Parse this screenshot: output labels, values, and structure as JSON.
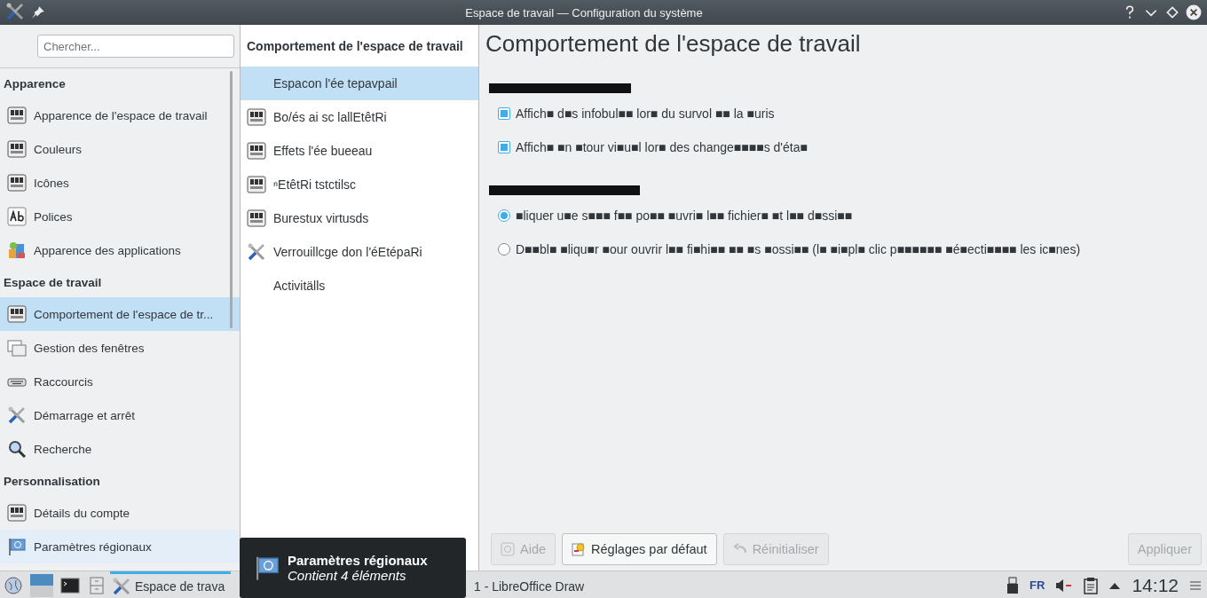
{
  "window": {
    "title": "Espace de travail — Configuration du système"
  },
  "sidebar": {
    "search": {
      "placeholder": "Chercher..."
    },
    "groups": [
      {
        "label": "Apparence",
        "items": [
          {
            "label": "Apparence de l'espace de travail",
            "kind": "module",
            "selected": false,
            "hovered": false
          },
          {
            "label": "Couleurs",
            "kind": "module",
            "selected": false,
            "hovered": false
          },
          {
            "label": "Icônes",
            "kind": "module",
            "selected": false,
            "hovered": false
          },
          {
            "label": "Polices",
            "kind": "font",
            "selected": false,
            "hovered": false
          },
          {
            "label": "Apparence des applications",
            "kind": "apps",
            "selected": false,
            "hovered": false
          }
        ]
      },
      {
        "label": "Espace de travail",
        "items": [
          {
            "label": "Comportement de l'espace de tr...",
            "kind": "module",
            "selected": true,
            "hovered": false
          },
          {
            "label": "Gestion des fenêtres",
            "kind": "windows",
            "selected": false,
            "hovered": false
          },
          {
            "label": "Raccourcis",
            "kind": "keyboard",
            "selected": false,
            "hovered": false
          },
          {
            "label": "Démarrage et arrêt",
            "kind": "tools",
            "selected": false,
            "hovered": false
          },
          {
            "label": "Recherche",
            "kind": "search",
            "selected": false,
            "hovered": false
          }
        ]
      },
      {
        "label": "Personnalisation",
        "items": [
          {
            "label": "Détails du compte",
            "kind": "module",
            "selected": false,
            "hovered": false
          },
          {
            "label": "Paramètres régionaux",
            "kind": "flag",
            "selected": false,
            "hovered": true
          }
        ]
      }
    ]
  },
  "modules": {
    "header": "Comportement de l'espace de travail",
    "items": [
      {
        "label": "Espacon l'ée tepavpail",
        "kind": "plain",
        "selected": true
      },
      {
        "label": "Bo/és ai sc lallEtêtRi",
        "kind": "module",
        "selected": false
      },
      {
        "label": "Effets l'ée bueeau",
        "kind": "module",
        "selected": false
      },
      {
        "label": "ⁿEtêtRi tstctilsc",
        "kind": "module",
        "selected": false
      },
      {
        "label": "Burestux virtusds",
        "kind": "module",
        "selected": false
      },
      {
        "label": "Verrouillcge don l'éEtépaRi",
        "kind": "tools",
        "selected": false
      },
      {
        "label": "Activitälls",
        "kind": "plain",
        "selected": false
      }
    ]
  },
  "page": {
    "title": "Comportement de l'espace de travail",
    "sections": [
      {
        "kind": "checkbox",
        "options": [
          {
            "label": "Affich■ d■s infobul■■ lor■ du survol ■■ la ■uris",
            "checked": true
          },
          {
            "label": "Affich■ ■n ■tour vi■u■l lor■ des change■■■■s d'éta■",
            "checked": true
          }
        ]
      },
      {
        "kind": "radio",
        "options": [
          {
            "label": "■liquer u■e s■■■ f■■ po■■ ■uvri■ l■■ fichier■ ■t l■■ d■ssi■■",
            "selected": true
          },
          {
            "label": "D■■bl■ ■liqu■r ■our ouvrir l■■ fi■hi■■ ■■ ■s ■ossi■■ (l■ ■i■pl■ clic p■■■■■■ ■é■ecti■■■■ les ic■nes)",
            "selected": false
          }
        ]
      }
    ],
    "buttons": [
      {
        "label": "Aide",
        "kind": "help",
        "disabled": true
      },
      {
        "label": "Réglages par défaut",
        "kind": "defaults",
        "disabled": false
      },
      {
        "label": "Réinitialiser",
        "kind": "reset",
        "disabled": true
      },
      {
        "label": "Appliquer",
        "kind": "plain",
        "disabled": true
      }
    ]
  },
  "taskbar": {
    "tasks": [
      {
        "label": "Espace de trava",
        "active": true
      },
      {
        "label": "1 - LibreOffice Draw",
        "active": false
      }
    ],
    "keyboard_layout": "FR",
    "clock": "14:12"
  },
  "tooltip": {
    "title": "Paramètres régionaux",
    "subtitle": "Contient 4 éléments"
  }
}
